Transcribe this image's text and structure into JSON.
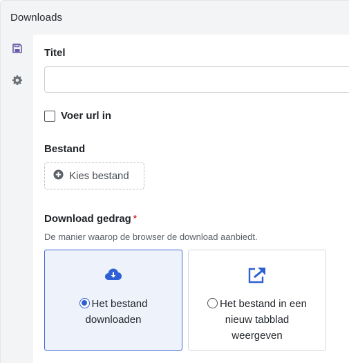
{
  "header": {
    "title": "Downloads"
  },
  "sidebar": {
    "items": [
      {
        "icon": "save-icon",
        "active": true
      },
      {
        "icon": "gear-icon",
        "active": false
      }
    ]
  },
  "form": {
    "title_label": "Titel",
    "title_value": "",
    "url_checkbox_label": "Voer url in",
    "file_label": "Bestand",
    "file_button_label": "Kies bestand",
    "behavior_label": "Download gedrag",
    "required_mark": "*",
    "behavior_hint": "De manier waarop de browser de download aanbiedt.",
    "options": [
      {
        "label_line1": "Het bestand",
        "label_line2": "downloaden",
        "label_line3": "",
        "icon": "cloud-download-icon",
        "selected": true
      },
      {
        "label_line1": "Het bestand in een",
        "label_line2": "nieuw tabblad",
        "label_line3": "weergeven",
        "icon": "external-link-icon",
        "selected": false
      }
    ]
  },
  "colors": {
    "accent": "#2f5fd4",
    "icon_muted": "#6b7178",
    "save_icon": "#6a5aa8",
    "required": "#d0312d"
  }
}
